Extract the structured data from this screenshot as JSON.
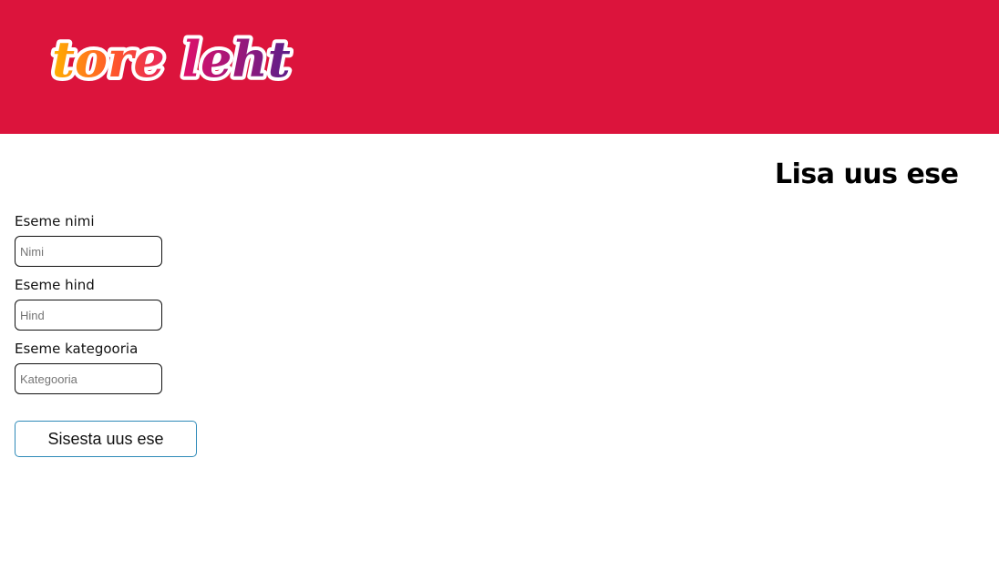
{
  "header": {
    "logo_text": "tore leht",
    "background_color": "#dc143c"
  },
  "main": {
    "title": "Lisa uus ese",
    "fields": [
      {
        "label": "Eseme nimi",
        "placeholder": "Nimi",
        "value": ""
      },
      {
        "label": "Eseme hind",
        "placeholder": "Hind",
        "value": ""
      },
      {
        "label": "Eseme kategooria",
        "placeholder": "Kategooria",
        "value": ""
      }
    ],
    "submit_label": "Sisesta uus ese",
    "submit_border_color": "#2e8ab8"
  }
}
